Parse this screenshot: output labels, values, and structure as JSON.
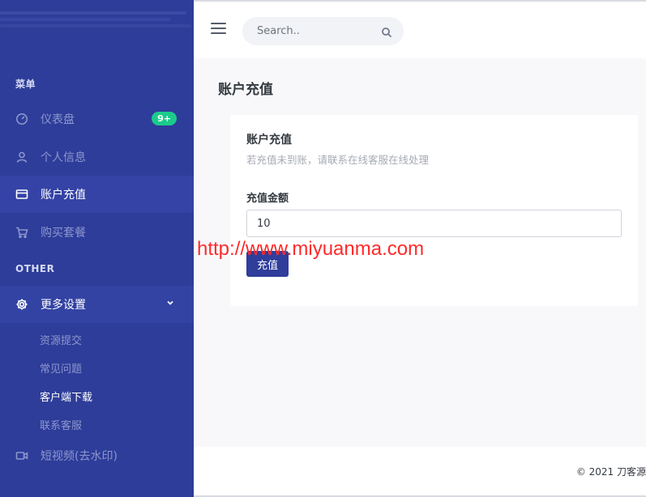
{
  "sidebar": {
    "menu_title": "菜单",
    "other_title": "OTHER",
    "items": [
      {
        "label": "仪表盘",
        "icon": "dashboard-icon",
        "badge": "9+"
      },
      {
        "label": "个人信息",
        "icon": "user-icon"
      },
      {
        "label": "账户充值",
        "icon": "credit-card-icon"
      },
      {
        "label": "购买套餐",
        "icon": "cart-icon"
      }
    ],
    "settings": {
      "label": "更多设置",
      "icon": "gear-icon",
      "children": [
        "资源提交",
        "常见问题",
        "客户端下载",
        "联系客服"
      ]
    },
    "video": {
      "label": "短视频(去水印)",
      "icon": "video-icon"
    }
  },
  "topbar": {
    "search_placeholder": "Search.."
  },
  "page": {
    "title": "账户充值",
    "card_title": "账户充值",
    "card_desc": "若充值未到账，请联系在线客服在线处理",
    "amount_label": "充值金额",
    "amount_value": "10",
    "submit_label": "充值"
  },
  "watermark": "http://www.miyuanma.com",
  "footer": {
    "text": "© 2021 刀客源"
  },
  "colors": {
    "sidebar": "#2e3d99",
    "accent": "#2f3d9b",
    "badge": "#1ccb8c",
    "watermark": "#ff2a2a"
  }
}
